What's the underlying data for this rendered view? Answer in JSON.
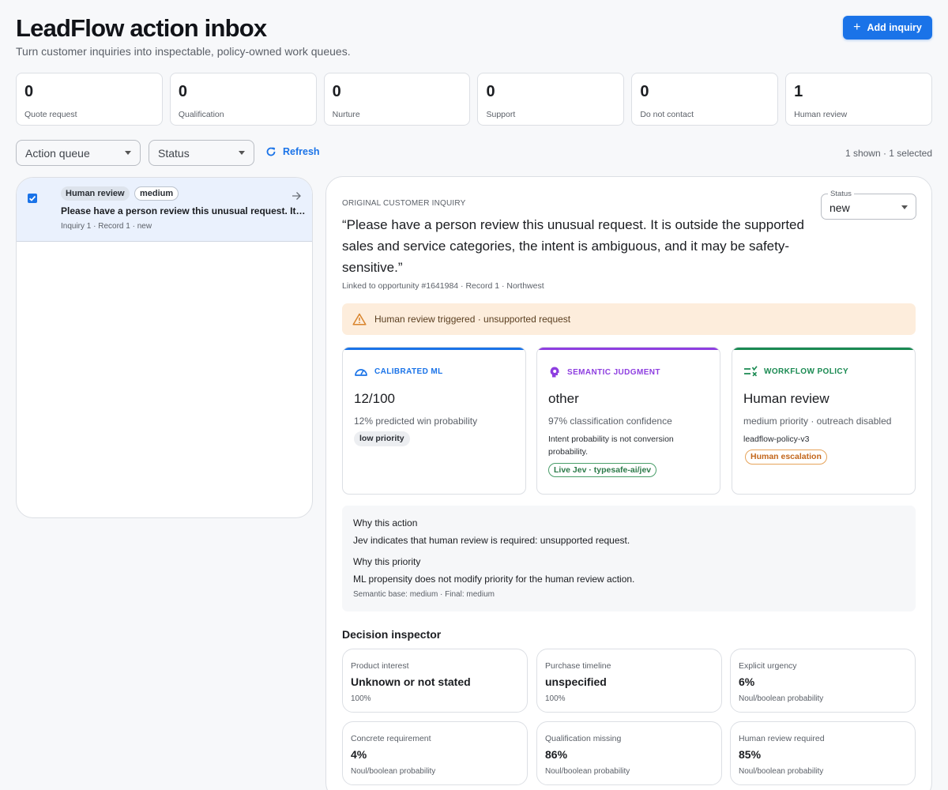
{
  "header": {
    "title": "LeadFlow action inbox",
    "subtitle": "Turn customer inquiries into inspectable, policy-owned work queues.",
    "add_button": "Add inquiry"
  },
  "metrics": [
    {
      "count": "0",
      "label": "Quote request"
    },
    {
      "count": "0",
      "label": "Qualification"
    },
    {
      "count": "0",
      "label": "Nurture"
    },
    {
      "count": "0",
      "label": "Support"
    },
    {
      "count": "0",
      "label": "Do not contact"
    },
    {
      "count": "1",
      "label": "Human review"
    }
  ],
  "filters": {
    "action_queue": "Action queue",
    "status": "Status",
    "refresh": "Refresh",
    "shown": "1 shown · 1 selected"
  },
  "list": {
    "items": [
      {
        "tag": "Human review",
        "priority": "medium",
        "title": "Please have a person review this unusual request. It is outside the supported sales and service categories",
        "meta": "Inquiry 1 · Record 1 · new",
        "checked": true
      }
    ]
  },
  "detail": {
    "eyebrow": "ORIGINAL CUSTOMER INQUIRY",
    "status_label": "Status",
    "status_value": "new",
    "quote": "“Please have a person review this unusual request. It is outside the supported sales and service categories, the intent is ambiguous, and it may be safety-sensitive.”",
    "linked": "Linked to opportunity #1641984 · Record 1 · Northwest",
    "alert": "Human review triggered · unsupported request",
    "cards": {
      "ml": {
        "heading": "CALIBRATED ML",
        "value": "12/100",
        "sub": "12% predicted win probability",
        "chip": "low priority",
        "color": "#1a73e8"
      },
      "semantic": {
        "heading": "SEMANTIC JUDGMENT",
        "value": "other",
        "sub": "97% classification confidence",
        "note": "Intent probability is not conversion probability.",
        "chip": "Live Jev · typesafe-ai/jev",
        "color": "#8e3ee0"
      },
      "policy": {
        "heading": "WORKFLOW POLICY",
        "value": "Human review",
        "sub": "medium priority · outreach disabled",
        "note": "leadflow-policy-v3",
        "chip": "Human escalation",
        "color": "#1a8a52"
      }
    },
    "why": {
      "action_heading": "Why this action",
      "action_text": "Jev indicates that human review is required: unsupported request.",
      "priority_heading": "Why this priority",
      "priority_text": "ML propensity does not modify priority for the human review action.",
      "base": "Semantic base: medium · Final: medium"
    },
    "inspector": {
      "title": "Decision inspector",
      "items": [
        {
          "label": "Product interest",
          "value": "Unknown or not stated",
          "foot": "100%"
        },
        {
          "label": "Purchase timeline",
          "value": "unspecified",
          "foot": "100%"
        },
        {
          "label": "Explicit urgency",
          "value": "6%",
          "foot": "Noul/boolean probability"
        },
        {
          "label": "Concrete requirement",
          "value": "4%",
          "foot": "Noul/boolean probability"
        },
        {
          "label": "Qualification missing",
          "value": "86%",
          "foot": "Noul/boolean probability"
        },
        {
          "label": "Human review required",
          "value": "85%",
          "foot": "Noul/boolean probability"
        }
      ]
    }
  }
}
